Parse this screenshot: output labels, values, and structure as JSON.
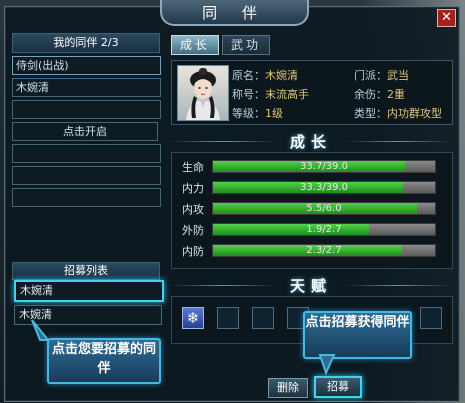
{
  "window": {
    "title": "同 伴",
    "close": "✕"
  },
  "companions": {
    "header": "我的同伴  2/3",
    "slots": [
      "侍剑(出战)",
      "木婉清",
      "",
      "点击开启",
      "",
      "",
      ""
    ]
  },
  "recruit": {
    "header": "招募列表",
    "items": [
      "木婉清",
      "木婉清"
    ]
  },
  "tabs": [
    {
      "label": "成长",
      "active": true
    },
    {
      "label": "武功",
      "active": false
    }
  ],
  "info": {
    "name_label": "原名：",
    "name": "木婉清",
    "sect_label": "门派：",
    "sect": "武当",
    "title_label": "称号：",
    "title": "末流高手",
    "injury_label": "余伤：",
    "injury": "2重",
    "level_label": "等级：",
    "level": "1级",
    "type_label": "类型：",
    "type": "内功群攻型"
  },
  "sections": {
    "growth": "成长",
    "talent": "天赋"
  },
  "stats": [
    {
      "label": "生命",
      "value": "33.7/39.0",
      "ratio": 0.864
    },
    {
      "label": "内力",
      "value": "33.3/39.0",
      "ratio": 0.854
    },
    {
      "label": "内攻",
      "value": "5.5/6.0",
      "ratio": 0.917
    },
    {
      "label": "外防",
      "value": "1.9/2.7",
      "ratio": 0.704
    },
    {
      "label": "内防",
      "value": "2.3/2.7",
      "ratio": 0.852
    }
  ],
  "talents": {
    "first_icon": "snowflake-icon",
    "first_glyph": "❄"
  },
  "buttons": {
    "delete": "删除",
    "recruit": "招募"
  },
  "tips": {
    "left": "点击您要招募的同伴",
    "right": "点击招募获得同伴"
  },
  "colors": {
    "accent": "#46d0ec",
    "bar": "#3cb534",
    "value_text": "#e3c57a"
  }
}
